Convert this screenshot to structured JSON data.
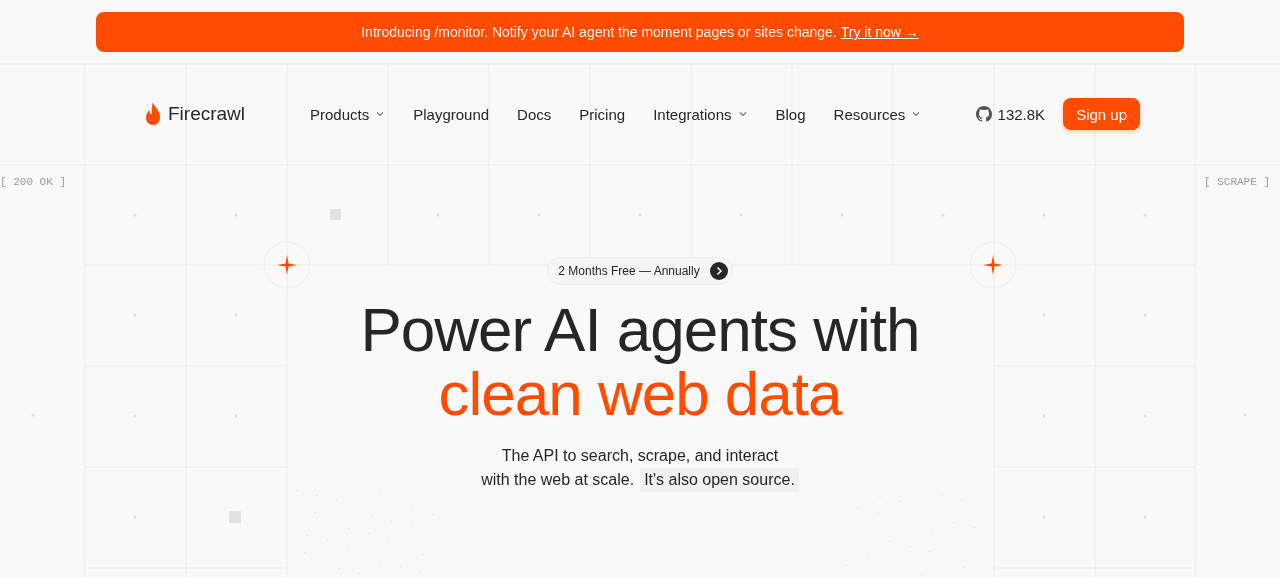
{
  "banner": {
    "text": "Introducing /monitor. Notify your AI agent the moment pages or sites change.",
    "link": "Try it now →"
  },
  "nav": {
    "logo": "Firecrawl",
    "items": [
      {
        "label": "Products",
        "has_menu": true
      },
      {
        "label": "Playground",
        "has_menu": false
      },
      {
        "label": "Docs",
        "has_menu": false
      },
      {
        "label": "Pricing",
        "has_menu": false
      },
      {
        "label": "Integrations",
        "has_menu": true
      },
      {
        "label": "Blog",
        "has_menu": false
      },
      {
        "label": "Resources",
        "has_menu": true
      }
    ],
    "stars": "132.8K",
    "signup": "Sign up"
  },
  "side_labels": {
    "left": "[ 200 OK ]",
    "right": "[ SCRAPE ]"
  },
  "hero": {
    "promo": "2 Months Free — Annually",
    "title_line1": "Power AI agents with",
    "title_line2": "clean web data",
    "subtitle_line1": "The API to search, scrape, and interact",
    "subtitle_line2": "with the web at scale.",
    "subtitle_highlight": "It's also open source."
  }
}
